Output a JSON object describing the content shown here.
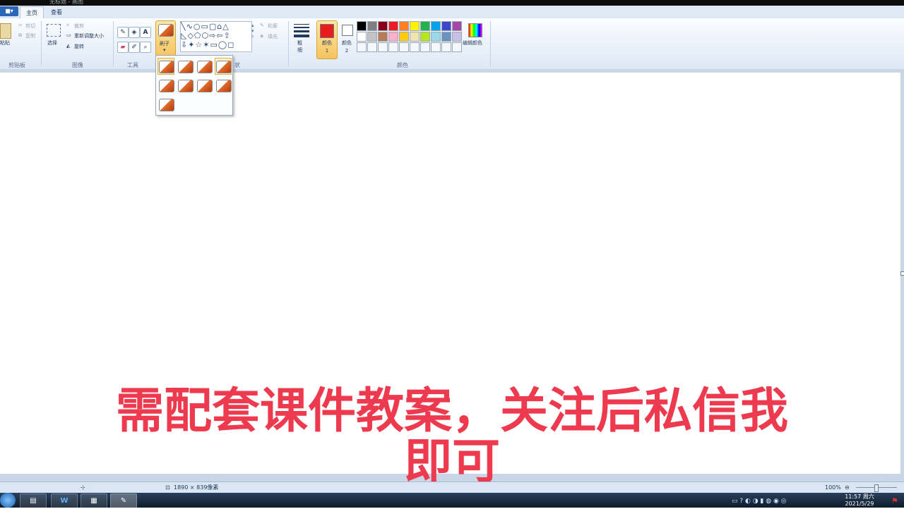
{
  "window": {
    "title": "无标题 - 画图"
  },
  "tabs": {
    "file": "■▾",
    "home": "主页",
    "view": "查看"
  },
  "clipboard": {
    "paste": "粘贴",
    "cut": "剪切",
    "copy": "复制",
    "group": "剪贴板"
  },
  "image": {
    "select": "选择",
    "crop": "裁剪",
    "resize": "重新调整大小",
    "rotate": "旋转",
    "group": "图像"
  },
  "tools": {
    "group": "工具",
    "text_tool": "A"
  },
  "brushes": {
    "label": "刷子",
    "dropdown_count": 9,
    "selected_index": 0,
    "hover_index": 3
  },
  "shapes": {
    "outline": "轮廓",
    "fill": "填充",
    "group_partial": "状"
  },
  "size": {
    "label": "粗细"
  },
  "colors": {
    "color1_label": "颜色 1",
    "color2_label": "颜色 2",
    "edit_colors": "编辑颜色",
    "group": "颜色",
    "color1": "#e81c1c",
    "color2": "#ffffff",
    "palette_row1": [
      "#000000",
      "#7f7f7f",
      "#880015",
      "#ed1c24",
      "#ff7f27",
      "#fff200",
      "#22b14c",
      "#00a2e8",
      "#3f48cc",
      "#a349a4"
    ],
    "palette_row2": [
      "#ffffff",
      "#c3c3c3",
      "#b97a57",
      "#ffaec9",
      "#ffc90e",
      "#efe4b0",
      "#b5e61d",
      "#99d9ea",
      "#7092be",
      "#c8bfe7"
    ]
  },
  "statusbar": {
    "dimensions": "1890 × 839像素",
    "zoom": "100%"
  },
  "taskbar": {
    "clock_time": "11:57 周六",
    "clock_date": "2021/5/29"
  },
  "overlay": {
    "line1": "需配套课件教案，关注后私信我",
    "line2": "即可"
  }
}
